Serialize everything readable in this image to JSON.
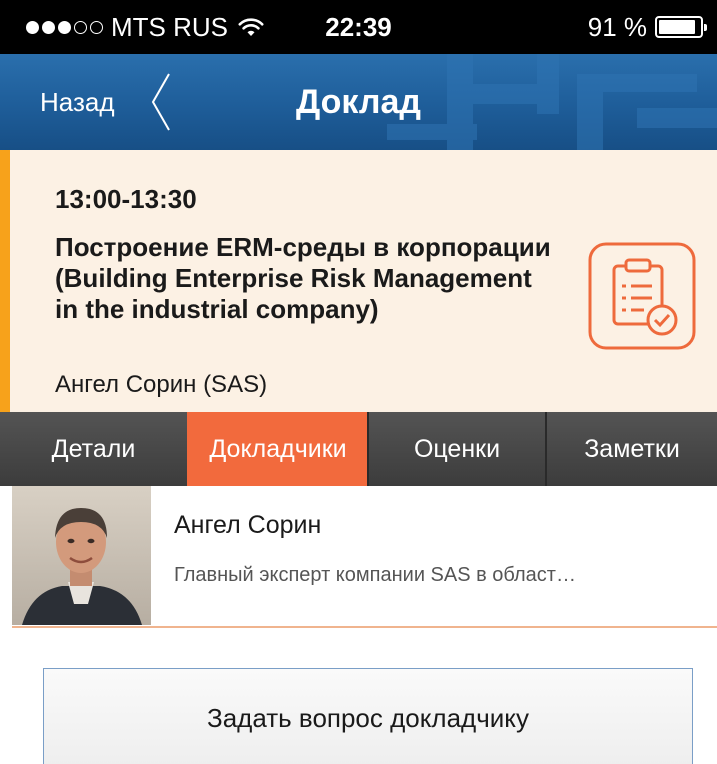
{
  "status_bar": {
    "signal_bars_filled": 3,
    "signal_bars_total": 5,
    "carrier": "MTS RUS",
    "time": "22:39",
    "battery_percent_label": "91 %",
    "battery_level": 0.91
  },
  "nav": {
    "back_label": "Назад",
    "title": "Доклад"
  },
  "session": {
    "time": "13:00-13:30",
    "title": "Построение ERM-среды в корпорации (Building Enterprise Risk Management in the industrial company)",
    "speaker_line": "Ангел Сорин (SAS)",
    "action_icon": "clipboard-check-icon",
    "accent_color": "#f7a21b",
    "card_bg": "#fcf1e4"
  },
  "tabs": [
    {
      "label": "Детали",
      "active": false
    },
    {
      "label": "Докладчики",
      "active": true
    },
    {
      "label": "Оценки",
      "active": false
    },
    {
      "label": "Заметки",
      "active": false
    }
  ],
  "speaker": {
    "name": "Ангел Сорин",
    "description": "Главный эксперт компании SAS в област…"
  },
  "ask_button": {
    "label": "Задать вопрос докладчику"
  },
  "colors": {
    "nav_blue": "#1e5d99",
    "active_tab": "#f26a3d",
    "icon_orange": "#ee6a3c"
  }
}
